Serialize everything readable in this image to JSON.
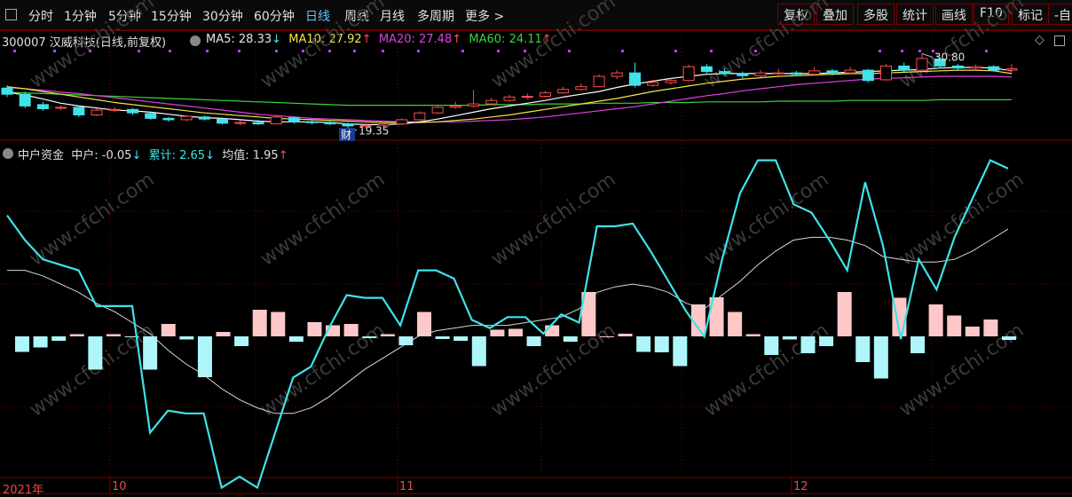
{
  "toolbar": {
    "periods": [
      "分时",
      "1分钟",
      "5分钟",
      "15分钟",
      "30分钟",
      "60分钟",
      "日线",
      "周线",
      "月线",
      "多周期",
      "更多 >"
    ],
    "active_period": "日线",
    "right_buttons": [
      "复权",
      "叠加",
      "多股",
      "统计",
      "画线",
      "F10",
      "标记",
      "-自"
    ]
  },
  "stock": {
    "code_name": "300007 汉威科技(日线,前复权)",
    "ma5_label": "MA5: 28.33",
    "ma5_arrow": "↓",
    "ma10_label": "MA10: 27.92",
    "ma10_arrow": "↑",
    "ma20_label": "MA20: 27.48",
    "ma20_arrow": "↑",
    "ma60_label": "MA60: 24.11",
    "ma60_arrow": "↑",
    "high_marker": "30.80",
    "low_marker": "19.35",
    "event_marker": "财"
  },
  "indicator": {
    "name": "中户资金",
    "zh_label": "中户: -0.05",
    "zh_arrow": "↓",
    "lj_label": "累计: 2.65",
    "lj_arrow": "↓",
    "jz_label": "均值: 1.95",
    "jz_arrow": "↑"
  },
  "xaxis": {
    "labels": [
      "2021年",
      "10",
      "11",
      "12"
    ]
  },
  "watermark": "www.cfchi.com",
  "colors": {
    "up": "#ff4d4d",
    "down": "#3fe3e8",
    "ma5": "#ffffff",
    "ma10": "#f4e64a",
    "ma20": "#e040e0",
    "ma60": "#38d438",
    "grid": "#7a0000",
    "accent": "#57c8ff"
  },
  "chart_data": [
    {
      "type": "candlestick",
      "title": "300007 汉威科技(日线,前复权)",
      "low_label": 19.35,
      "high_label": 30.8,
      "candles": [
        {
          "o": 25.8,
          "c": 24.9,
          "h": 26.2,
          "l": 24.5
        },
        {
          "o": 24.9,
          "c": 23.2,
          "h": 25.3,
          "l": 22.9
        },
        {
          "o": 23.4,
          "c": 22.8,
          "h": 23.8,
          "l": 22.5
        },
        {
          "o": 22.9,
          "c": 23.0,
          "h": 23.3,
          "l": 22.6
        },
        {
          "o": 23.0,
          "c": 21.9,
          "h": 23.2,
          "l": 21.6
        },
        {
          "o": 21.9,
          "c": 22.6,
          "h": 22.8,
          "l": 21.7
        },
        {
          "o": 22.6,
          "c": 22.7,
          "h": 23.0,
          "l": 22.3
        },
        {
          "o": 22.7,
          "c": 22.2,
          "h": 22.9,
          "l": 21.9
        },
        {
          "o": 22.1,
          "c": 21.4,
          "h": 22.3,
          "l": 21.2
        },
        {
          "o": 21.4,
          "c": 21.2,
          "h": 21.6,
          "l": 20.9
        },
        {
          "o": 21.2,
          "c": 21.7,
          "h": 21.9,
          "l": 21.0
        },
        {
          "o": 21.6,
          "c": 21.3,
          "h": 21.8,
          "l": 21.1
        },
        {
          "o": 21.3,
          "c": 20.7,
          "h": 21.4,
          "l": 20.5
        },
        {
          "o": 20.7,
          "c": 20.8,
          "h": 21.1,
          "l": 20.4
        },
        {
          "o": 20.8,
          "c": 20.6,
          "h": 21.2,
          "l": 20.4
        },
        {
          "o": 20.6,
          "c": 21.6,
          "h": 21.8,
          "l": 20.5
        },
        {
          "o": 21.5,
          "c": 20.9,
          "h": 21.7,
          "l": 20.6
        },
        {
          "o": 20.9,
          "c": 20.8,
          "h": 21.3,
          "l": 20.5
        },
        {
          "o": 20.8,
          "c": 20.6,
          "h": 21.0,
          "l": 20.4
        },
        {
          "o": 20.6,
          "c": 20.3,
          "h": 20.8,
          "l": 19.35
        },
        {
          "o": 20.3,
          "c": 20.4,
          "h": 20.7,
          "l": 20.0
        },
        {
          "o": 20.4,
          "c": 20.6,
          "h": 20.9,
          "l": 20.2
        },
        {
          "o": 20.6,
          "c": 21.2,
          "h": 21.4,
          "l": 20.5
        },
        {
          "o": 21.2,
          "c": 22.2,
          "h": 22.4,
          "l": 21.1
        },
        {
          "o": 22.2,
          "c": 23.0,
          "h": 23.3,
          "l": 22.0
        },
        {
          "o": 23.0,
          "c": 23.2,
          "h": 23.8,
          "l": 22.8
        },
        {
          "o": 23.2,
          "c": 23.5,
          "h": 25.5,
          "l": 23.0
        },
        {
          "o": 23.5,
          "c": 24.0,
          "h": 24.4,
          "l": 23.3
        },
        {
          "o": 24.0,
          "c": 24.5,
          "h": 24.8,
          "l": 23.8
        },
        {
          "o": 24.5,
          "c": 24.6,
          "h": 25.0,
          "l": 24.2
        },
        {
          "o": 24.6,
          "c": 25.1,
          "h": 25.4,
          "l": 24.4
        },
        {
          "o": 25.1,
          "c": 25.6,
          "h": 26.0,
          "l": 25.0
        },
        {
          "o": 25.6,
          "c": 26.0,
          "h": 26.5,
          "l": 25.4
        },
        {
          "o": 26.0,
          "c": 27.5,
          "h": 27.8,
          "l": 25.9
        },
        {
          "o": 27.5,
          "c": 28.0,
          "h": 28.4,
          "l": 27.1
        },
        {
          "o": 28.0,
          "c": 26.2,
          "h": 29.5,
          "l": 25.9
        },
        {
          "o": 26.2,
          "c": 26.6,
          "h": 27.0,
          "l": 26.0
        },
        {
          "o": 26.6,
          "c": 26.9,
          "h": 27.2,
          "l": 26.3
        },
        {
          "o": 26.9,
          "c": 28.9,
          "h": 29.2,
          "l": 26.8
        },
        {
          "o": 28.9,
          "c": 28.2,
          "h": 29.3,
          "l": 27.8
        },
        {
          "o": 28.2,
          "c": 27.9,
          "h": 28.6,
          "l": 27.6
        },
        {
          "o": 27.9,
          "c": 27.6,
          "h": 28.2,
          "l": 27.2
        },
        {
          "o": 27.6,
          "c": 28.0,
          "h": 28.4,
          "l": 27.4
        },
        {
          "o": 28.0,
          "c": 28.0,
          "h": 28.6,
          "l": 27.7
        },
        {
          "o": 28.0,
          "c": 27.8,
          "h": 28.3,
          "l": 27.5
        },
        {
          "o": 27.8,
          "c": 28.3,
          "h": 28.8,
          "l": 27.6
        },
        {
          "o": 28.3,
          "c": 28.0,
          "h": 28.6,
          "l": 27.6
        },
        {
          "o": 28.0,
          "c": 28.4,
          "h": 28.9,
          "l": 27.8
        },
        {
          "o": 28.4,
          "c": 26.9,
          "h": 28.6,
          "l": 26.6
        },
        {
          "o": 27.0,
          "c": 29.0,
          "h": 29.3,
          "l": 26.9
        },
        {
          "o": 29.0,
          "c": 28.4,
          "h": 29.5,
          "l": 28.1
        },
        {
          "o": 28.4,
          "c": 30.1,
          "h": 30.8,
          "l": 28.2
        },
        {
          "o": 30.0,
          "c": 29.0,
          "h": 30.3,
          "l": 28.7
        },
        {
          "o": 29.0,
          "c": 28.7,
          "h": 29.3,
          "l": 28.4
        },
        {
          "o": 28.7,
          "c": 28.9,
          "h": 29.2,
          "l": 28.5
        },
        {
          "o": 28.9,
          "c": 28.4,
          "h": 29.1,
          "l": 28.2
        },
        {
          "o": 28.4,
          "c": 28.6,
          "h": 29.3,
          "l": 28.0
        }
      ],
      "ma5": [
        25.2,
        24.8,
        24.2,
        23.6,
        23.2,
        22.9,
        22.6,
        22.5,
        22.3,
        22.0,
        21.7,
        21.5,
        21.4,
        21.2,
        21.0,
        20.9,
        20.9,
        20.9,
        20.8,
        20.6,
        20.5,
        20.5,
        20.6,
        20.9,
        21.3,
        21.8,
        22.3,
        22.8,
        23.2,
        23.6,
        24.0,
        24.5,
        24.9,
        25.3,
        25.9,
        26.4,
        26.8,
        27.2,
        27.5,
        27.8,
        27.9,
        27.9,
        27.9,
        27.9,
        27.9,
        27.9,
        28.0,
        28.1,
        28.2,
        28.3,
        28.4,
        28.5,
        28.7,
        28.8,
        28.8,
        28.7,
        28.3
      ],
      "ma10": [
        26.0,
        25.7,
        25.3,
        24.9,
        24.5,
        24.1,
        23.7,
        23.4,
        23.1,
        22.8,
        22.5,
        22.2,
        22.0,
        21.8,
        21.6,
        21.4,
        21.3,
        21.2,
        21.1,
        21.0,
        20.9,
        20.8,
        20.8,
        20.8,
        20.9,
        21.1,
        21.3,
        21.6,
        21.9,
        22.3,
        22.7,
        23.1,
        23.5,
        23.9,
        24.3,
        24.8,
        25.3,
        25.7,
        26.1,
        26.5,
        26.8,
        27.1,
        27.3,
        27.5,
        27.6,
        27.7,
        27.8,
        27.9,
        27.9,
        28.0,
        28.1,
        28.2,
        28.3,
        28.4,
        28.4,
        28.3,
        27.9
      ],
      "ma20": [
        25.9,
        25.7,
        25.5,
        25.2,
        25.0,
        24.7,
        24.4,
        24.1,
        23.8,
        23.5,
        23.2,
        22.9,
        22.6,
        22.3,
        22.0,
        21.8,
        21.6,
        21.4,
        21.3,
        21.2,
        21.1,
        21.0,
        20.9,
        20.9,
        20.9,
        20.9,
        21.0,
        21.1,
        21.2,
        21.4,
        21.6,
        21.9,
        22.2,
        22.5,
        22.8,
        23.1,
        23.5,
        23.9,
        24.3,
        24.7,
        25.0,
        25.4,
        25.7,
        26.0,
        26.3,
        26.5,
        26.7,
        26.9,
        27.1,
        27.2,
        27.3,
        27.4,
        27.5,
        27.5,
        27.5,
        27.5,
        27.4
      ],
      "ma60": [
        25.2,
        25.1,
        25.0,
        24.9,
        24.8,
        24.7,
        24.6,
        24.5,
        24.4,
        24.3,
        24.2,
        24.1,
        24.0,
        23.9,
        23.8,
        23.7,
        23.6,
        23.5,
        23.4,
        23.3,
        23.3,
        23.3,
        23.3,
        23.3,
        23.3,
        23.3,
        23.3,
        23.4,
        23.4,
        23.4,
        23.5,
        23.5,
        23.5,
        23.6,
        23.6,
        23.6,
        23.7,
        23.7,
        23.7,
        23.8,
        23.8,
        23.8,
        23.8,
        23.9,
        23.9,
        23.9,
        23.9,
        24.0,
        24.0,
        24.0,
        24.0,
        24.0,
        24.1,
        24.1,
        24.1,
        24.1,
        24.1
      ]
    },
    {
      "type": "bar+line",
      "title": "中户资金",
      "series": [
        {
          "name": "中户",
          "values": [
            -0.35,
            -0.25,
            -0.1,
            0.05,
            -0.75,
            0.05,
            -0.01,
            -0.75,
            0.28,
            -0.07,
            -0.92,
            0.1,
            -0.22,
            0.6,
            0.55,
            -0.12,
            0.32,
            0.25,
            0.28,
            -0.04,
            0.05,
            -0.2,
            0.55,
            -0.06,
            -0.1,
            -0.67,
            0.15,
            0.17,
            -0.22,
            0.25,
            -0.12,
            1.0,
            0.0,
            0.06,
            -0.35,
            -0.36,
            -0.67,
            0.72,
            0.88,
            0.55,
            0.05,
            -0.42,
            -0.07,
            -0.38,
            -0.22,
            1.0,
            -0.58,
            -0.95,
            0.87,
            -0.38,
            0.72,
            0.47,
            0.22,
            0.38,
            -0.08
          ]
        },
        {
          "name": "累计",
          "values": [
            2.2,
            1.75,
            1.4,
            1.3,
            1.2,
            0.55,
            0.55,
            0.55,
            -1.75,
            -1.35,
            -1.4,
            -1.4,
            -2.75,
            -2.55,
            -2.75,
            -1.75,
            -0.75,
            -0.55,
            0.15,
            0.75,
            0.7,
            0.7,
            0.2,
            1.2,
            1.2,
            1.05,
            0.3,
            0.15,
            0.35,
            0.35,
            0.05,
            0.4,
            0.25,
            2.0,
            2.0,
            2.05,
            1.55,
            1.0,
            0.45,
            0.0,
            1.4,
            2.6,
            3.2,
            3.2,
            2.4,
            2.25,
            1.75,
            1.2,
            2.8,
            1.65,
            -0.05,
            1.4,
            0.85,
            1.8,
            2.5,
            3.2,
            3.05
          ]
        },
        {
          "name": "均值",
          "values": [
            1.2,
            1.2,
            1.1,
            0.95,
            0.8,
            0.6,
            0.45,
            0.25,
            0.05,
            -0.25,
            -0.5,
            -0.7,
            -0.95,
            -1.15,
            -1.3,
            -1.4,
            -1.4,
            -1.3,
            -1.1,
            -0.85,
            -0.6,
            -0.4,
            -0.2,
            0.0,
            0.1,
            0.15,
            0.2,
            0.2,
            0.2,
            0.25,
            0.3,
            0.35,
            0.5,
            0.8,
            0.9,
            0.95,
            0.9,
            0.8,
            0.6,
            0.5,
            0.75,
            1.0,
            1.3,
            1.55,
            1.75,
            1.8,
            1.8,
            1.75,
            1.65,
            1.45,
            1.4,
            1.35,
            1.35,
            1.4,
            1.55,
            1.75,
            1.95
          ]
        }
      ]
    }
  ]
}
